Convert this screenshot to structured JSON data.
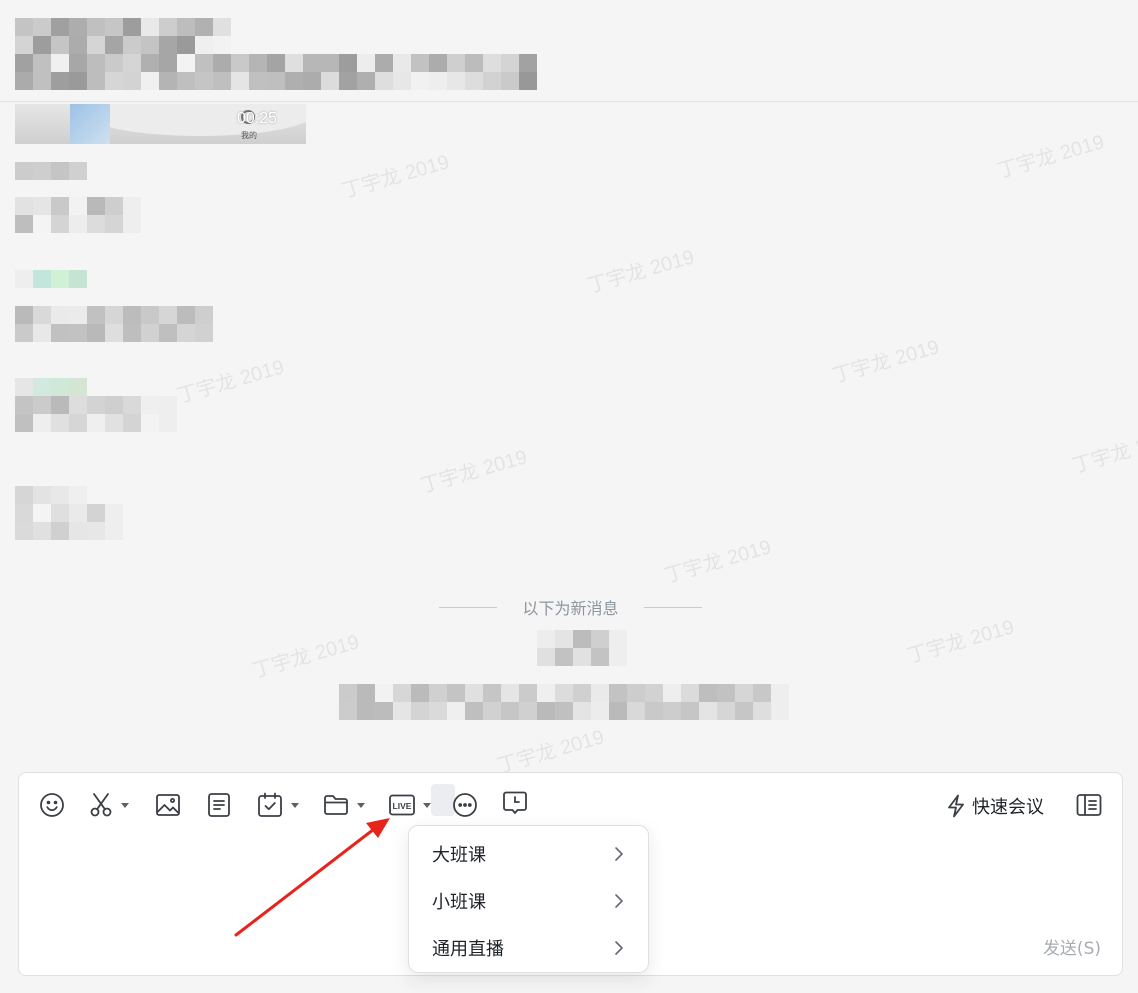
{
  "watermark": {
    "text": "丁宇龙 2019"
  },
  "video": {
    "duration": "00:25",
    "tag": "我的"
  },
  "new_messages_divider": "以下为新消息",
  "toolbar": {
    "items": [
      {
        "name": "emoji-icon"
      },
      {
        "name": "scissors-icon",
        "dropdown": true
      },
      {
        "name": "image-icon"
      },
      {
        "name": "doc-icon"
      },
      {
        "name": "calendar-check-icon",
        "dropdown": true
      },
      {
        "name": "folder-icon",
        "dropdown": true
      },
      {
        "name": "live-icon",
        "label": "LIVE",
        "dropdown": true,
        "active": true
      },
      {
        "name": "more-icon"
      },
      {
        "name": "schedule-message-icon"
      }
    ],
    "quick_meeting": "快速会议",
    "send_hint": "发送(S)"
  },
  "live_dropdown": {
    "items": [
      {
        "label": "大班课"
      },
      {
        "label": "小班课"
      },
      {
        "label": "通用直播"
      }
    ]
  },
  "colors": {
    "background": "#f5f5f5",
    "composer": "#ffffff",
    "annotation_arrow": "#e8231c",
    "muted_text": "#8f959e"
  }
}
